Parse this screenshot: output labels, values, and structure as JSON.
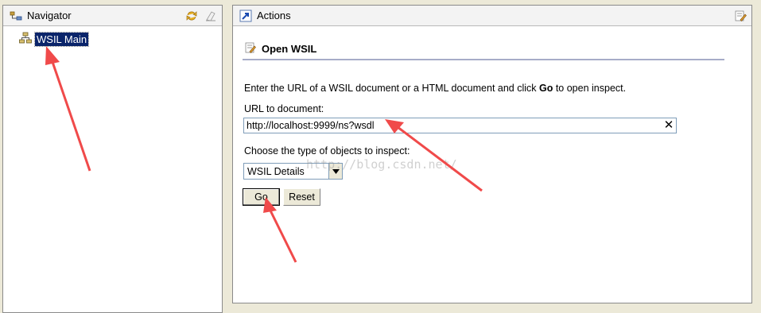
{
  "navigator": {
    "title": "Navigator",
    "tree": [
      {
        "label": "WSIL Main",
        "icon": "tree-hierarchy-icon",
        "selected": true
      }
    ]
  },
  "actions": {
    "title": "Actions",
    "section_title": "Open WSIL",
    "instruction_prefix": "Enter the URL of a WSIL document or a HTML document and click ",
    "instruction_bold": "Go",
    "instruction_suffix": " to open inspect.",
    "url_label": "URL to document:",
    "url_value": "http://localhost:9999/ns?wsdl",
    "url_clear": "✕",
    "type_label": "Choose the type of objects to inspect:",
    "type_selected": "WSIL Details",
    "go_label": "Go",
    "reset_label": "Reset"
  },
  "watermark": "http://blog.csdn.net/",
  "colors": {
    "selection": "#0a246a",
    "annotation_arrow": "#f04a4a",
    "section_rule": "#a6acc8"
  }
}
